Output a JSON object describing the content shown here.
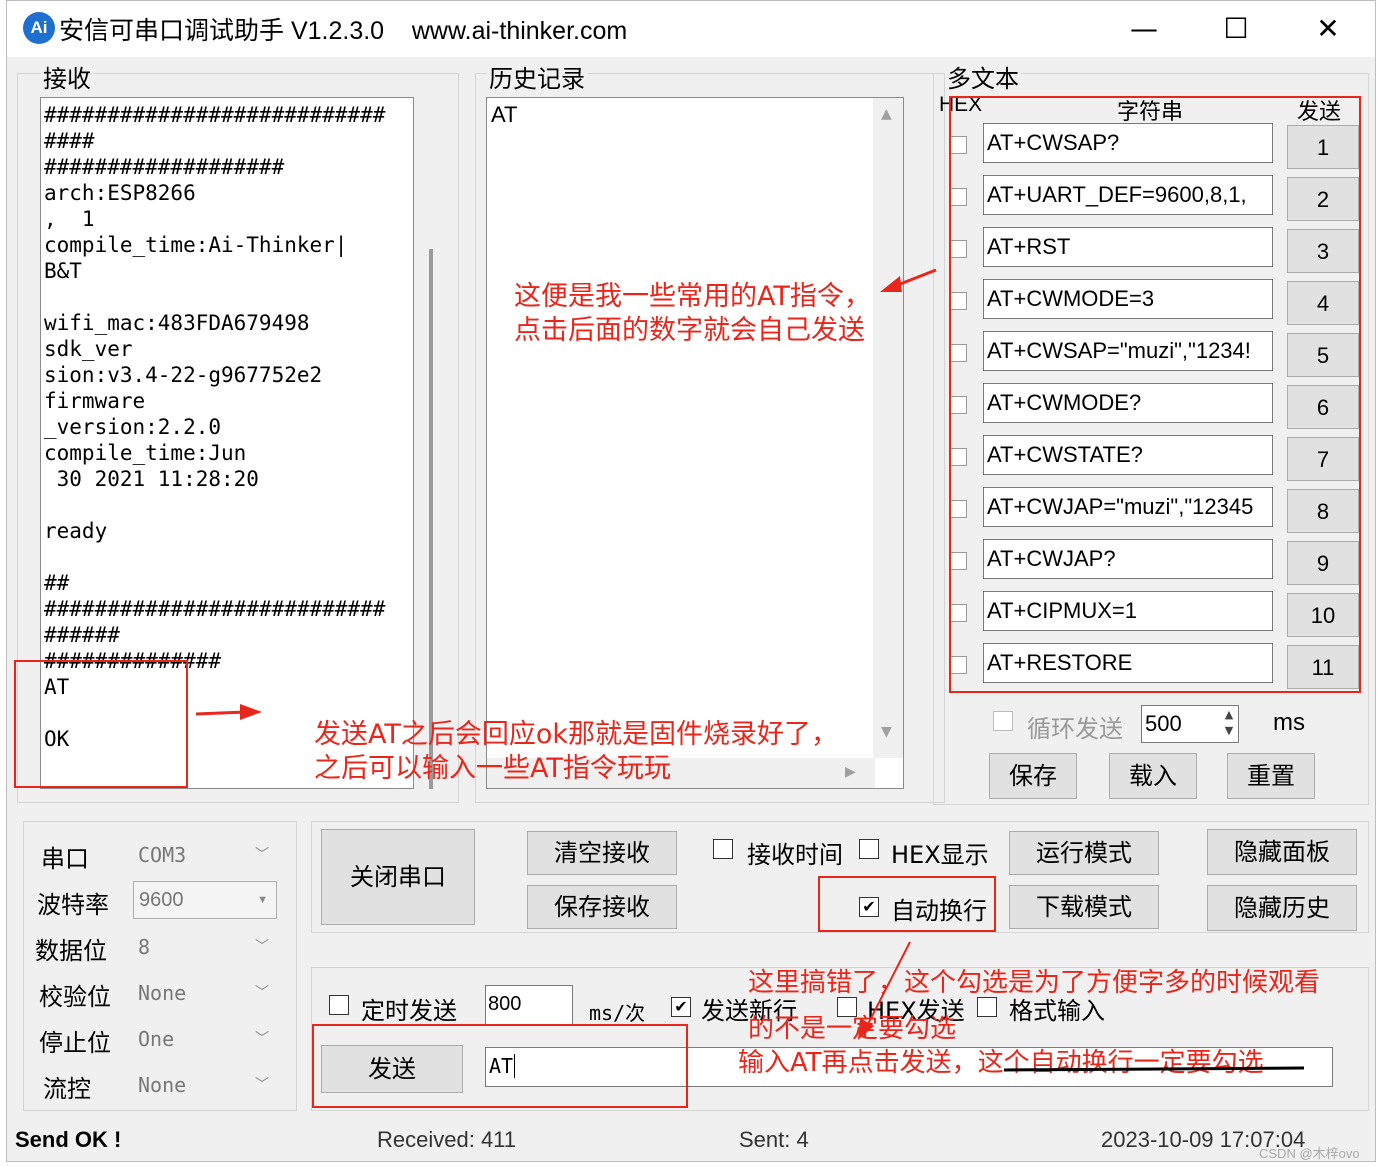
{
  "window": {
    "title": "安信可串口调试助手 V1.2.3.0    www.ai-thinker.com",
    "logo": "Ai",
    "minimize": "—",
    "maximize": "☐",
    "close": "✕"
  },
  "receive": {
    "label": "接收",
    "lines": [
      "###########################",
      "####",
      "###################",
      "arch:ESP8266",
      ",  1",
      "compile_time:Ai-Thinker|",
      "B&T",
      "",
      "wifi_mac:483FDA679498",
      "sdk_ver",
      "sion:v3.4-22-g967752e2",
      "firmware",
      "_version:2.2.0",
      "compile_time:Jun",
      " 30 2021 11:28:20",
      "",
      "ready",
      "",
      "##",
      "###########################",
      "######",
      "##############",
      "AT",
      "",
      "OK"
    ]
  },
  "history": {
    "label": "历史记录",
    "items": [
      "AT"
    ]
  },
  "multitext": {
    "label": "多文本",
    "col_hex": "HEX",
    "col_string": "字符串",
    "col_send": "发送",
    "rows": [
      {
        "cmd": "AT+CWSAP?",
        "num": "1"
      },
      {
        "cmd": "AT+UART_DEF=9600,8,1,",
        "num": "2"
      },
      {
        "cmd": "AT+RST",
        "num": "3"
      },
      {
        "cmd": "AT+CWMODE=3",
        "num": "4"
      },
      {
        "cmd": "AT+CWSAP=\"muzi\",\"1234!",
        "num": "5"
      },
      {
        "cmd": "AT+CWMODE?",
        "num": "6"
      },
      {
        "cmd": "AT+CWSTATE?",
        "num": "7"
      },
      {
        "cmd": "AT+CWJAP=\"muzi\",\"12345",
        "num": "8"
      },
      {
        "cmd": "AT+CWJAP?",
        "num": "9"
      },
      {
        "cmd": "AT+CIPMUX=1",
        "num": "10"
      },
      {
        "cmd": "AT+RESTORE",
        "num": "11"
      }
    ],
    "loop_send": "循环发送",
    "loop_interval": "500",
    "ms": "ms",
    "save": "保存",
    "load": "载入",
    "reset": "重置"
  },
  "port": {
    "port_label": "串口",
    "port_value": "COM3",
    "baud_label": "波特率",
    "baud_value": "9600",
    "data_label": "数据位",
    "data_value": "8",
    "parity_label": "校验位",
    "parity_value": "None",
    "stop_label": "停止位",
    "stop_value": "One",
    "flow_label": "流控",
    "flow_value": "None"
  },
  "controls": {
    "close_port": "关闭串口",
    "clear_recv": "清空接收",
    "save_recv": "保存接收",
    "recv_time": "接收时间",
    "hex_display": "HEX显示",
    "auto_wrap": "自动换行",
    "run_mode": "运行模式",
    "download_mode": "下载模式",
    "hide_panel": "隐藏面板",
    "hide_history": "隐藏历史"
  },
  "send": {
    "timed_send": "定时发送",
    "interval": "800",
    "unit": "ms/次",
    "newline": "发送新行",
    "hex_send": "HEX发送",
    "format_input": "格式输入",
    "send_button": "发送",
    "input_value": "AT"
  },
  "status": {
    "message": "Send OK !",
    "received": "Received: 411",
    "sent": "Sent: 4",
    "time": "2023-10-09 17:07:04",
    "watermark": "CSDN @木梓ovo"
  },
  "annotations": {
    "cmds_note_1": "这便是我一些常用的AT指令，",
    "cmds_note_2": "点击后面的数字就会自己发送",
    "ok_note_1": "发送AT之后会回应ok那就是固件烧录好了，",
    "ok_note_2": "之后可以输入一些AT指令玩玩",
    "wrap_note_1": "这里搞错了，这个勾选是为了方便字多的时候观看",
    "wrap_note_2": "的不是一定要勾选",
    "send_note": "输入AT再点击发送，这个自动换行一定要勾选"
  },
  "colors": {
    "annotation": "#e8261c",
    "logo": "#1e6fd0"
  }
}
